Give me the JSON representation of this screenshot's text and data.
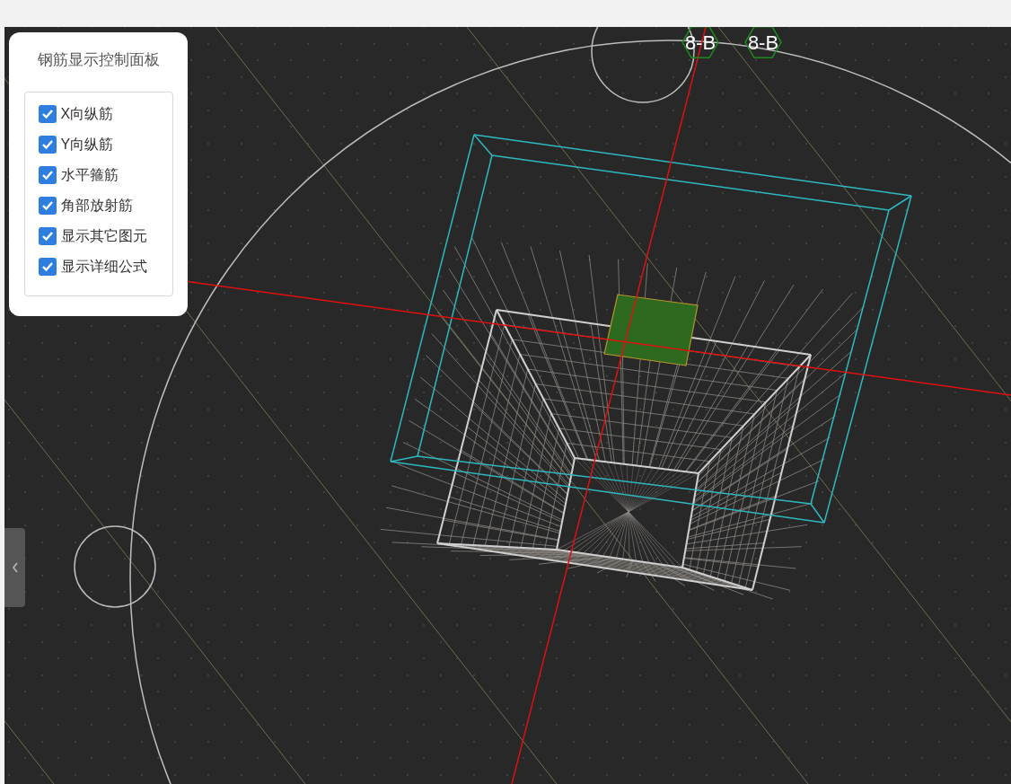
{
  "panel": {
    "title": "钢筋显示控制面板",
    "options": [
      {
        "label": "X向纵筋",
        "checked": true
      },
      {
        "label": "Y向纵筋",
        "checked": true
      },
      {
        "label": "水平箍筋",
        "checked": true
      },
      {
        "label": "角部放射筋",
        "checked": true
      },
      {
        "label": "显示其它图元",
        "checked": true
      },
      {
        "label": "显示详细公式",
        "checked": true
      }
    ]
  },
  "axis_labels": [
    {
      "text": "8-B"
    },
    {
      "text": "8-B"
    }
  ]
}
